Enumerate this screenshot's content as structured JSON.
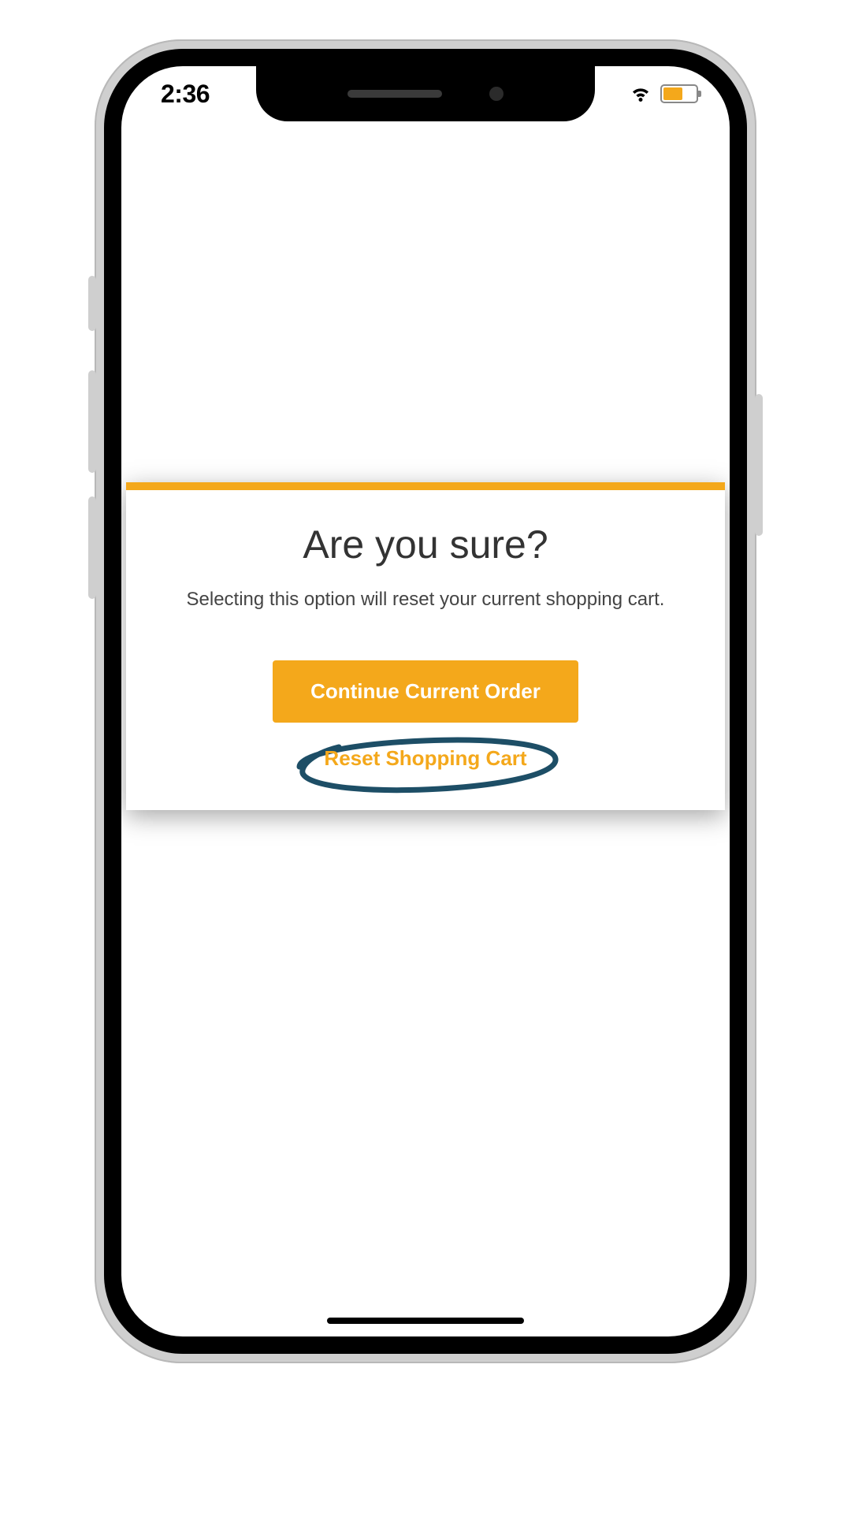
{
  "status_bar": {
    "time": "2:36"
  },
  "modal": {
    "title": "Are you sure?",
    "message": "Selecting this option will reset your current shopping cart.",
    "primary_label": "Continue Current Order",
    "secondary_label": "Reset Shopping Cart"
  },
  "colors": {
    "accent": "#f4a81b",
    "annotation": "#1d4e66"
  }
}
